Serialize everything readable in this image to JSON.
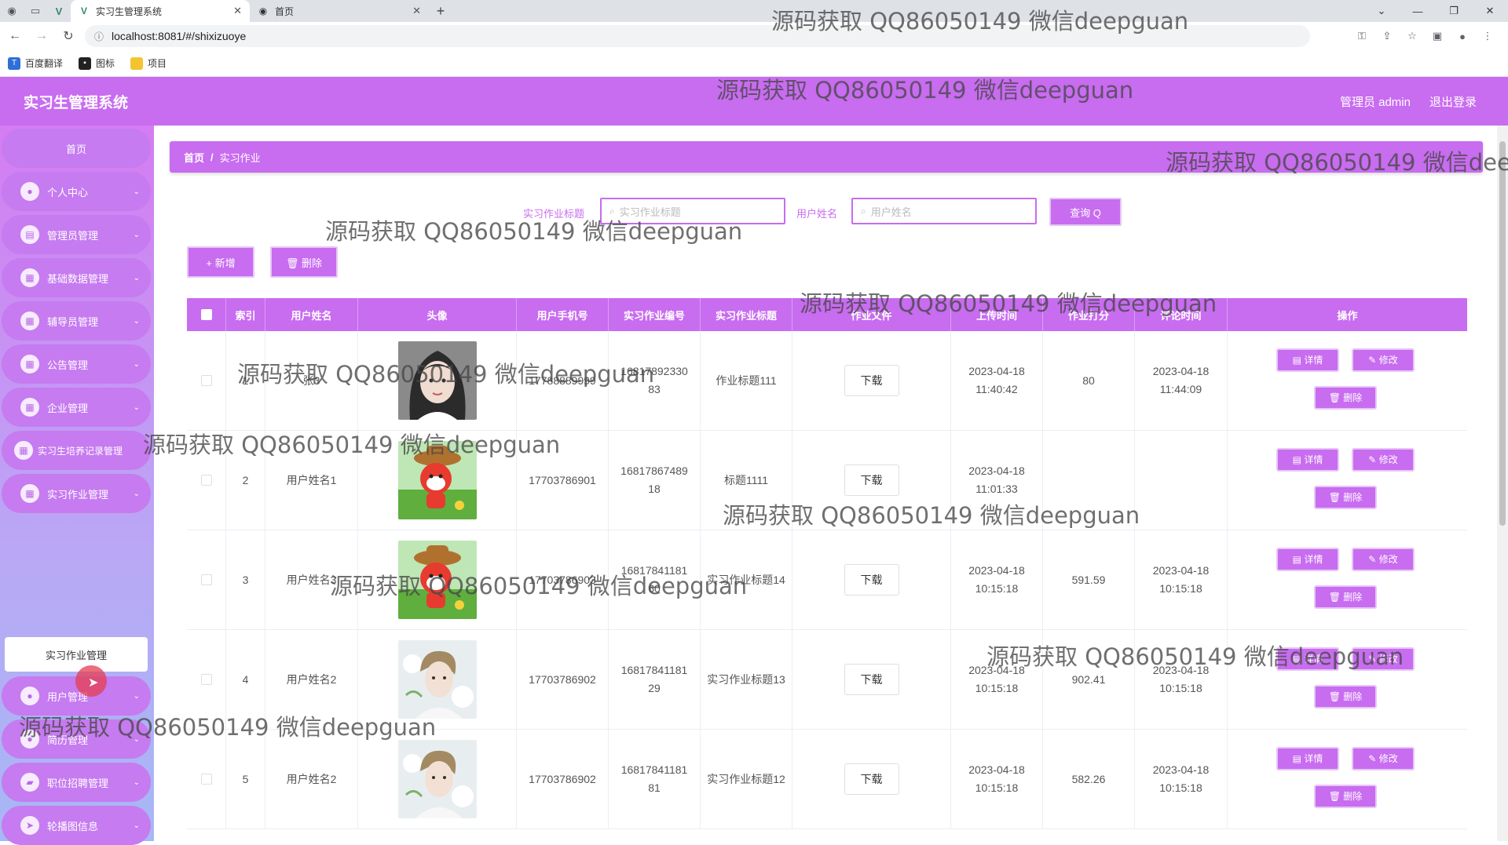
{
  "browser": {
    "tabs": [
      {
        "title": "实习生管理系统",
        "active": true
      },
      {
        "title": "首页",
        "active": false
      }
    ],
    "url": "localhost:8081/#/shixizuoye",
    "bookmarks": [
      "百度翻译",
      "图标",
      "项目"
    ]
  },
  "header": {
    "app_title": "实习生管理系统",
    "user_label": "管理员 admin",
    "logout_label": "退出登录",
    "brand_color": "#c86cf0"
  },
  "sidebar": {
    "home": "首页",
    "items": [
      {
        "label": "个人中心",
        "icon": "user-icon"
      },
      {
        "label": "管理员管理",
        "icon": "chat-icon"
      },
      {
        "label": "基础数据管理",
        "icon": "grid-icon"
      },
      {
        "label": "辅导员管理",
        "icon": "grid-icon"
      },
      {
        "label": "公告管理",
        "icon": "grid-icon"
      },
      {
        "label": "企业管理",
        "icon": "grid-icon"
      },
      {
        "label": "实习生培养记录管理",
        "icon": "grid-icon"
      },
      {
        "label": "实习作业管理",
        "icon": "grid-icon"
      },
      {
        "label": "用户管理",
        "icon": "user-icon"
      },
      {
        "label": "简历管理",
        "icon": "user-icon"
      },
      {
        "label": "职位招聘管理",
        "icon": "briefcase-icon"
      },
      {
        "label": "轮播图信息",
        "icon": "send-icon"
      }
    ],
    "submenu_active": "实习作业管理"
  },
  "breadcrumb": {
    "home": "首页",
    "sep": "/",
    "current": "实习作业"
  },
  "search": {
    "title_label": "实习作业标题",
    "title_placeholder": "实习作业标题",
    "name_label": "用户姓名",
    "name_placeholder": "用户姓名",
    "query_button": "查询 Q"
  },
  "actions": {
    "add": "+ 新增",
    "delete": "🗑 删除"
  },
  "table": {
    "headers": [
      "索引",
      "用户姓名",
      "头像",
      "用户手机号",
      "实习作业编号",
      "实习作业标题",
      "作业文件",
      "上传时间",
      "作业打分",
      "评论时间",
      "操作"
    ],
    "download_label": "下载",
    "op_detail": "详情",
    "op_edit": "修改",
    "op_delete": "删除",
    "rows": [
      {
        "index": "1",
        "name": "张3",
        "avatar": "girl",
        "phone": "17788889999",
        "number": "1681789233083",
        "title": "作业标题111",
        "upload_time": "2023-04-18 11:40:42",
        "score": "80",
        "comment_time": "2023-04-18 11:44:09"
      },
      {
        "index": "2",
        "name": "用户姓名1",
        "avatar": "cartoon",
        "phone": "17703786901",
        "number": "1681786748918",
        "title": "标题1111",
        "upload_time": "2023-04-18 11:01:33",
        "score": "",
        "comment_time": ""
      },
      {
        "index": "3",
        "name": "用户姓名3",
        "avatar": "cartoon",
        "phone": "17703786903",
        "number": "1681784118160",
        "title": "实习作业标题14",
        "upload_time": "2023-04-18 10:15:18",
        "score": "591.59",
        "comment_time": "2023-04-18 10:15:18"
      },
      {
        "index": "4",
        "name": "用户姓名2",
        "avatar": "boy",
        "phone": "17703786902",
        "number": "1681784118129",
        "title": "实习作业标题13",
        "upload_time": "2023-04-18 10:15:18",
        "score": "902.41",
        "comment_time": "2023-04-18 10:15:18"
      },
      {
        "index": "5",
        "name": "用户姓名2",
        "avatar": "boy",
        "phone": "17703786902",
        "number": "1681784118181",
        "title": "实习作业标题12",
        "upload_time": "2023-04-18 10:15:18",
        "score": "582.26",
        "comment_time": "2023-04-18 10:15:18"
      }
    ]
  },
  "watermark": "源码获取 QQ86050149 微信deepguan"
}
